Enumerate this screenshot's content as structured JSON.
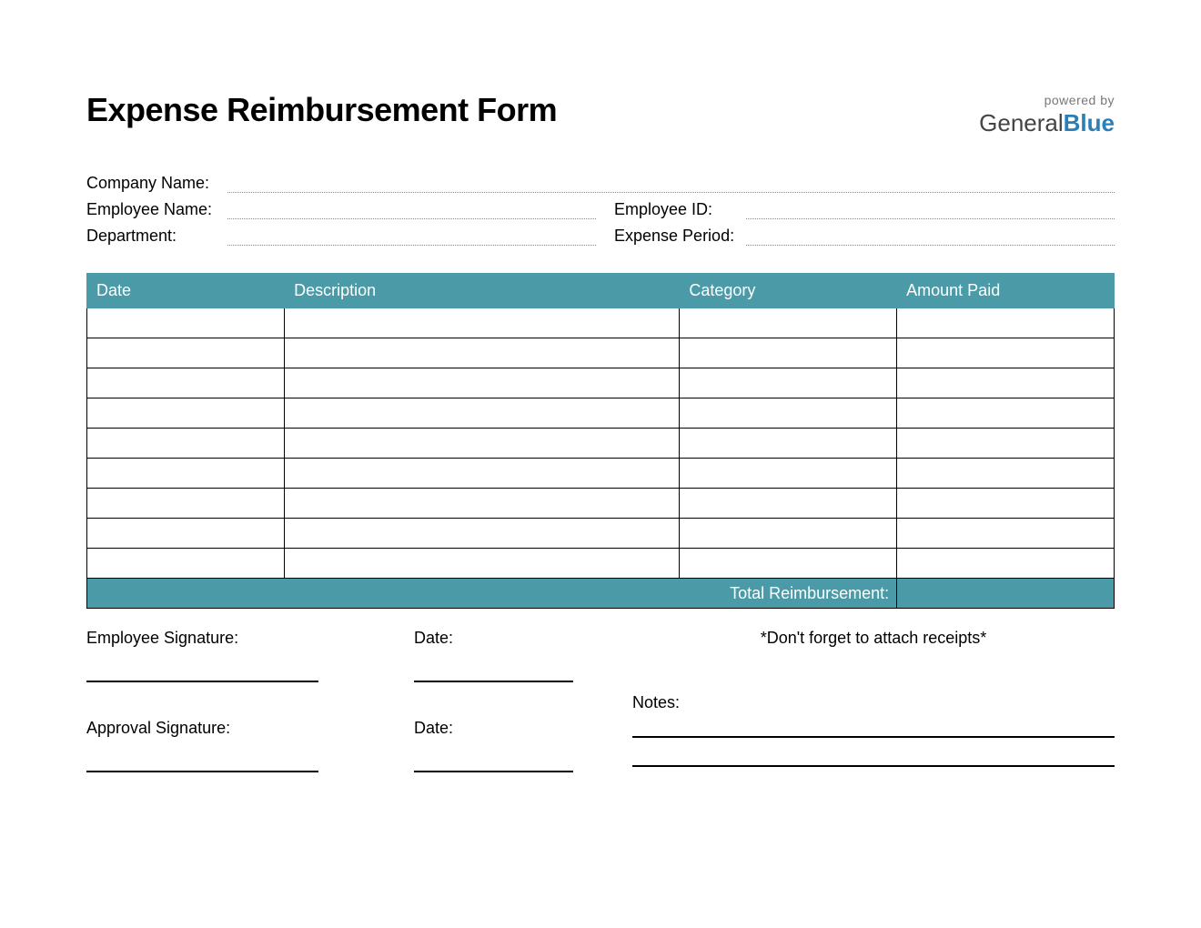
{
  "title": "Expense Reimbursement Form",
  "brand": {
    "powered": "powered by",
    "name1": "General",
    "name2": "Blue"
  },
  "info": {
    "company_label": "Company Name:",
    "employee_label": "Employee Name:",
    "empid_label": "Employee ID:",
    "dept_label": "Department:",
    "period_label": "Expense Period:"
  },
  "table": {
    "headers": {
      "date": "Date",
      "description": "Description",
      "category": "Category",
      "amount": "Amount Paid"
    },
    "total_label": "Total Reimbursement:"
  },
  "footer": {
    "emp_sig": "Employee Signature:",
    "date": "Date:",
    "reminder": "*Don't forget to attach receipts*",
    "approval_sig": "Approval Signature:",
    "notes": "Notes:"
  }
}
